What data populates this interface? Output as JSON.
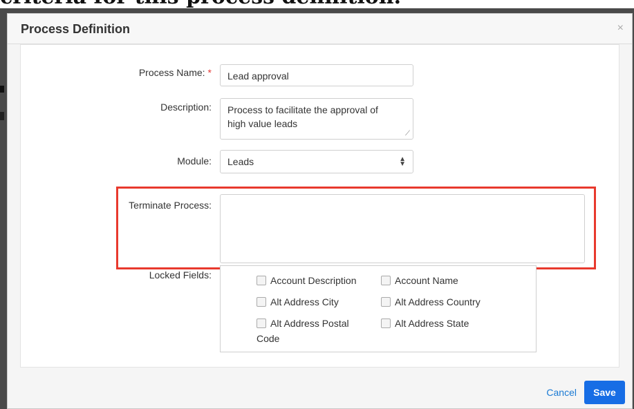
{
  "background": {
    "caption": "criteria for this process definition."
  },
  "modal": {
    "title": "Process Definition",
    "close_icon": "×"
  },
  "form": {
    "process_name": {
      "label": "Process Name:",
      "required_mark": "*",
      "value": "Lead approval"
    },
    "description": {
      "label": "Description:",
      "value_line1": "Process to facilitate the approval of",
      "value_line2": "high value leads"
    },
    "module": {
      "label": "Module:",
      "value": "Leads"
    },
    "terminate_process": {
      "label": "Terminate Process:",
      "value": ""
    },
    "locked_fields": {
      "label": "Locked Fields:",
      "items": [
        {
          "label": "Account Description",
          "checked": false
        },
        {
          "label": "Account Name",
          "checked": false
        },
        {
          "label": "Alt Address City",
          "checked": false
        },
        {
          "label": "Alt Address Country",
          "checked": false
        },
        {
          "label_line1": "Alt Address Postal",
          "label_line2": "Code",
          "checked": false
        },
        {
          "label": "Alt Address State",
          "checked": false
        }
      ]
    }
  },
  "footer": {
    "cancel_label": "Cancel",
    "save_label": "Save"
  },
  "colors": {
    "highlight_border": "#e8392d",
    "primary_button": "#176de5",
    "link": "#1a7ad4",
    "required": "#e53935"
  }
}
